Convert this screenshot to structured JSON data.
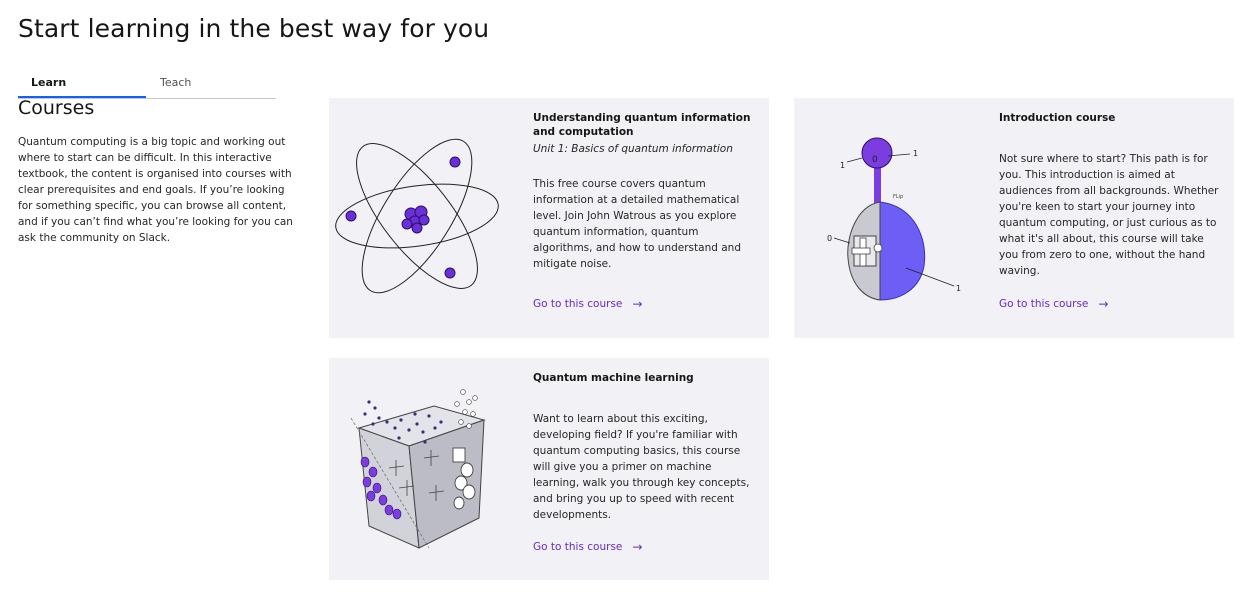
{
  "page": {
    "title": "Start learning in the best way for you"
  },
  "tabs": [
    {
      "label": "Learn",
      "active": true
    },
    {
      "label": "Teach",
      "active": false
    }
  ],
  "sidebar": {
    "heading": "Courses",
    "description": "Quantum computing is a big topic and working out where to start can be difficult. In this interactive textbook, the content is organised into courses with clear prerequisites and end goals. If you’re looking for something specific, you can browse all content, and if you can’t find what you’re looking for you can ask the community on Slack."
  },
  "cards": [
    {
      "title": "Understanding quantum information and computation",
      "subtitle": "Unit 1: Basics of quantum information",
      "description": "This free course covers quantum information at a detailed mathematical level. Join John Watrous as you explore quantum information, quantum algorithms, and how to understand and mitigate noise.",
      "link": "Go to this course",
      "link_icon": "arrow-right-icon",
      "art": "atom-illustration"
    },
    {
      "title": "Introduction course",
      "description": "Not sure where to start? This path is for you. This introduction is aimed at audiences from all backgrounds. Whether you're keen to start your journey into quantum computing, or just curious as to what it's all about, this course will take you from zero to one, without the hand waving.",
      "link": "Go to this course",
      "link_icon": "arrow-right-icon",
      "art": "bloch-sphere-illustration",
      "art_labels": {
        "top_zero": "0",
        "top_one_left": "1",
        "top_one_right": "1",
        "side_zero": "0",
        "bottom_one": "1",
        "tag": "FLip"
      }
    },
    {
      "title": "Quantum machine learning",
      "description": "Want to learn about this exciting, developing field? If you're familiar with quantum computing basics, this course will give you a primer on machine learning, walk you through key concepts, and bring you up to speed with recent developments.",
      "link": "Go to this course",
      "link_icon": "arrow-right-icon",
      "art": "data-cube-illustration"
    }
  ],
  "colors": {
    "accent_purple": "#6929c4",
    "illustration_purple": "#7c3ce0",
    "card_background": "#f2f2f6",
    "tab_underline": "#0f62fe"
  }
}
